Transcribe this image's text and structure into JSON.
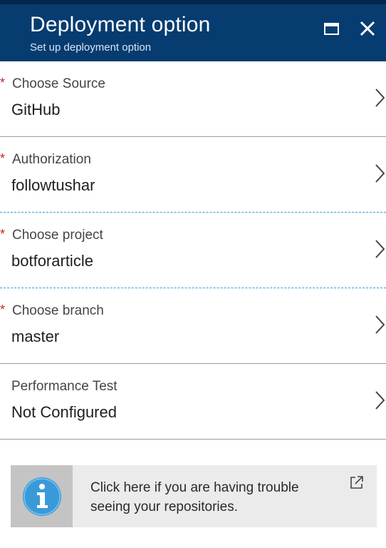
{
  "header": {
    "title": "Deployment option",
    "subtitle": "Set up deployment option",
    "maximize_icon": "maximize-icon",
    "close_icon": "close-icon",
    "background_color": "#063c70"
  },
  "rows": [
    {
      "label": "Choose Source",
      "value": "GitHub",
      "required": true
    },
    {
      "label": "Authorization",
      "value": "followtushar",
      "required": true
    },
    {
      "label": "Choose project",
      "value": "botforarticle",
      "required": true
    },
    {
      "label": "Choose branch",
      "value": "master",
      "required": true
    },
    {
      "label": "Performance Test",
      "value": "Not Configured",
      "required": false
    }
  ],
  "required_marker": "*",
  "info": {
    "text": "Click here if you are having trouble seeing your repositories.",
    "icon": "info-icon",
    "link_icon": "external-link-icon",
    "icon_color": "#3a9ad9"
  }
}
